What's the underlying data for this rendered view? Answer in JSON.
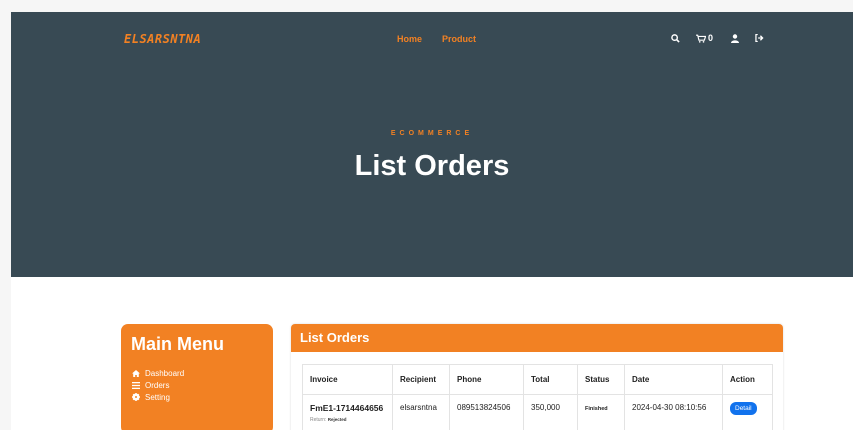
{
  "brand": {
    "logo": "ELSARSNTNA",
    "accent": "#f28123",
    "hero_bg": "#384a54"
  },
  "nav": {
    "links": [
      "Home",
      "Product"
    ]
  },
  "header_icons": {
    "search": "search-icon",
    "cart": "cart-icon",
    "cart_count": "0",
    "user": "user-icon",
    "logout": "sign-out-icon"
  },
  "hero": {
    "subtitle": "ECOMMERCE",
    "title": "List Orders"
  },
  "sidebar": {
    "title": "Main Menu",
    "items": [
      {
        "label": "Dashboard",
        "icon": "home-icon"
      },
      {
        "label": "Orders",
        "icon": "list-icon"
      },
      {
        "label": "Setting",
        "icon": "gear-icon"
      }
    ]
  },
  "orders": {
    "title": "List Orders",
    "columns": [
      "Invoice",
      "Recipient",
      "Phone",
      "Total",
      "Status",
      "Date",
      "Action"
    ],
    "rows": [
      {
        "invoice": "FmE1-1714464656",
        "return_label": "Return:",
        "return_status": "Rejected",
        "recipient": "elsarsntna",
        "phone": "089513824506",
        "total": "350,000",
        "status": "Finished",
        "date": "2024-04-30 08:10:56",
        "action": "Detail"
      }
    ]
  }
}
